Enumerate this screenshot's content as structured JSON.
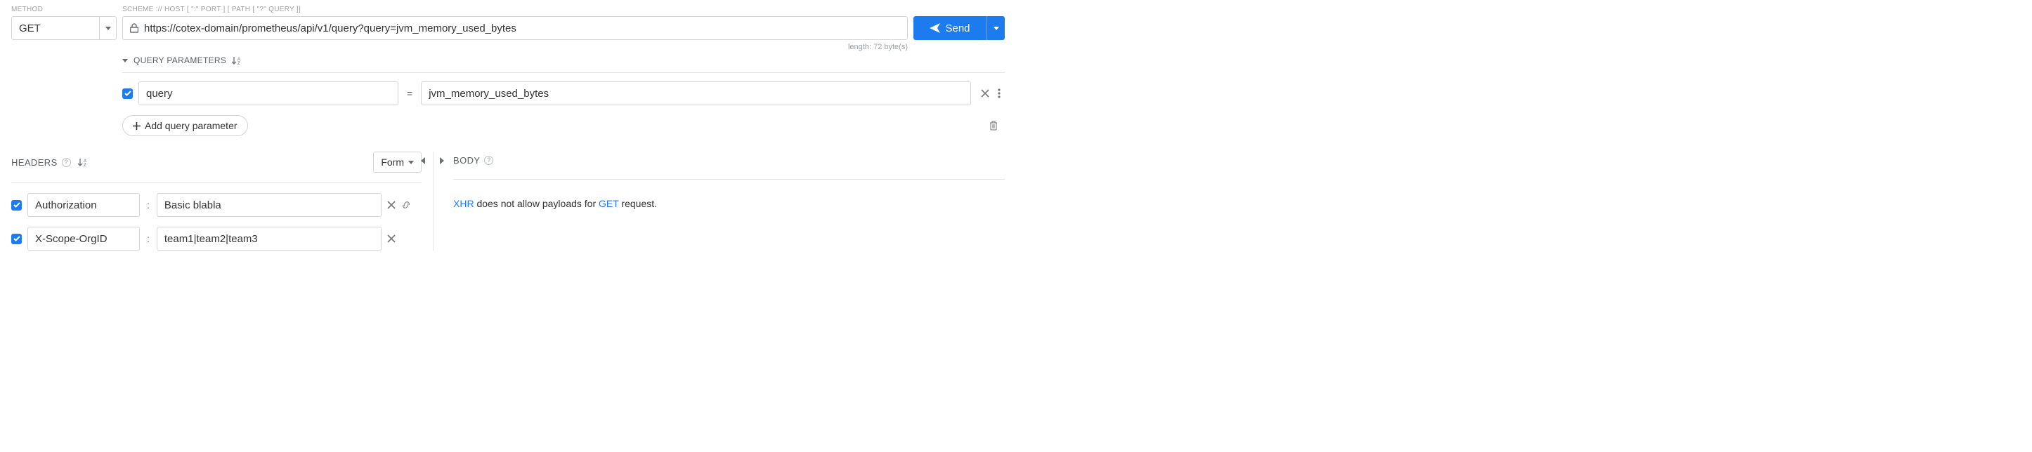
{
  "labels": {
    "method": "METHOD",
    "scheme": "SCHEME :// HOST [ \":\" PORT ] [ PATH [ \"?\" QUERY ]]",
    "headers": "HEADERS",
    "body": "BODY",
    "query_params": "QUERY PARAMETERS"
  },
  "method": {
    "value": "GET"
  },
  "url": {
    "value": "https://cotex-domain/prometheus/api/v1/query?query=jvm_memory_used_bytes"
  },
  "length_text": "length: 72 byte(s)",
  "send": {
    "label": "Send"
  },
  "query_params": [
    {
      "enabled": true,
      "key": "query",
      "value": "jvm_memory_used_bytes"
    }
  ],
  "add_param_label": "Add query parameter",
  "headers_view": {
    "mode": "Form"
  },
  "headers": [
    {
      "enabled": true,
      "key": "Authorization",
      "value": "Basic blabla",
      "has_link": true
    },
    {
      "enabled": true,
      "key": "X-Scope-OrgID",
      "value": "team1|team2|team3",
      "has_link": false
    }
  ],
  "body_message": {
    "pre": "XHR",
    "mid": " does not allow payloads for ",
    "method": "GET",
    "post": " request."
  }
}
